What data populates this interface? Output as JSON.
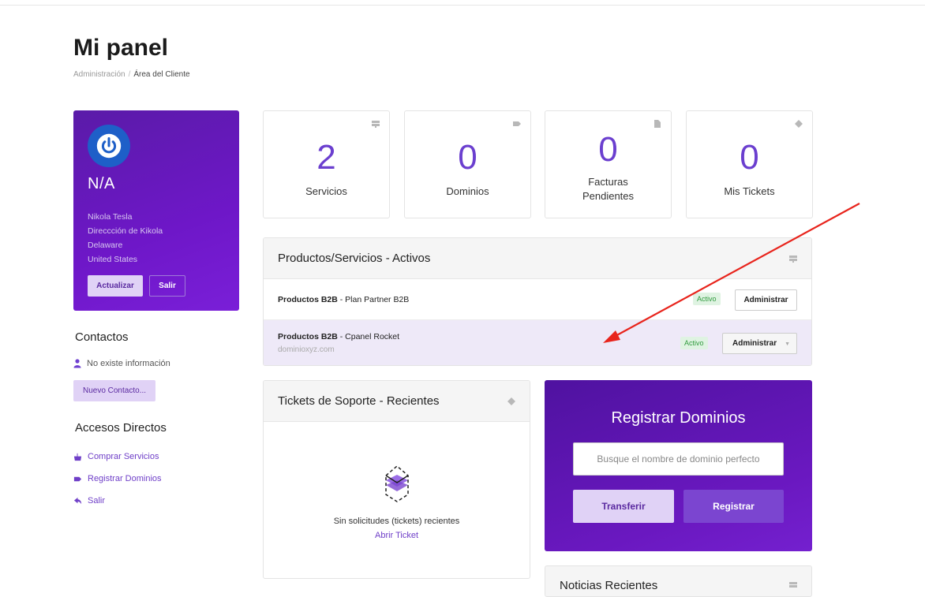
{
  "page": {
    "title": "Mi panel",
    "breadcrumb": [
      "Administración",
      "Área del Cliente"
    ]
  },
  "profile": {
    "name": "N/A",
    "address_lines": [
      "Nikola Tesla",
      "Direccción de Kikola",
      "Delaware",
      "United States"
    ],
    "update_label": "Actualizar",
    "exit_label": "Salir",
    "accent": "#6e17c8"
  },
  "contacts": {
    "title": "Contactos",
    "empty_text": "No existe información",
    "new_label": "Nuevo Contacto..."
  },
  "shortcuts": {
    "title": "Accesos Directos",
    "items": [
      {
        "label": "Comprar Servicios",
        "icon": "basket-icon"
      },
      {
        "label": "Registrar Dominios",
        "icon": "tag-icon"
      },
      {
        "label": "Salir",
        "icon": "back-arrow-icon"
      }
    ]
  },
  "stats": [
    {
      "value": "2",
      "label": "Servicios",
      "icon": "server-icon"
    },
    {
      "value": "0",
      "label": "Dominios",
      "icon": "tag-icon"
    },
    {
      "value": "0",
      "label": "Facturas Pendientes",
      "icon": "document-icon"
    },
    {
      "value": "0",
      "label": "Mis Tickets",
      "icon": "ticket-icon"
    }
  ],
  "products": {
    "title": "Productos/Servicios - Activos",
    "rows": [
      {
        "group": "Productos B2B",
        "name": " - Plan Partner B2B",
        "domain": "",
        "status": "Activo",
        "action": "Administrar"
      },
      {
        "group": "Productos B2B",
        "name": " - Cpanel Rocket",
        "domain": "dominioxyz.com",
        "status": "Activo",
        "action": "Administrar"
      }
    ]
  },
  "tickets": {
    "title": "Tickets de Soporte - Recientes",
    "empty_text": "Sin solicitudes (tickets) recientes",
    "open_link": "Abrir Ticket"
  },
  "domain_register": {
    "title": "Registrar Dominios",
    "placeholder": "Busque el nombre de dominio perfecto",
    "transfer_label": "Transferir",
    "register_label": "Registrar"
  },
  "news": {
    "title": "Noticias Recientes"
  }
}
